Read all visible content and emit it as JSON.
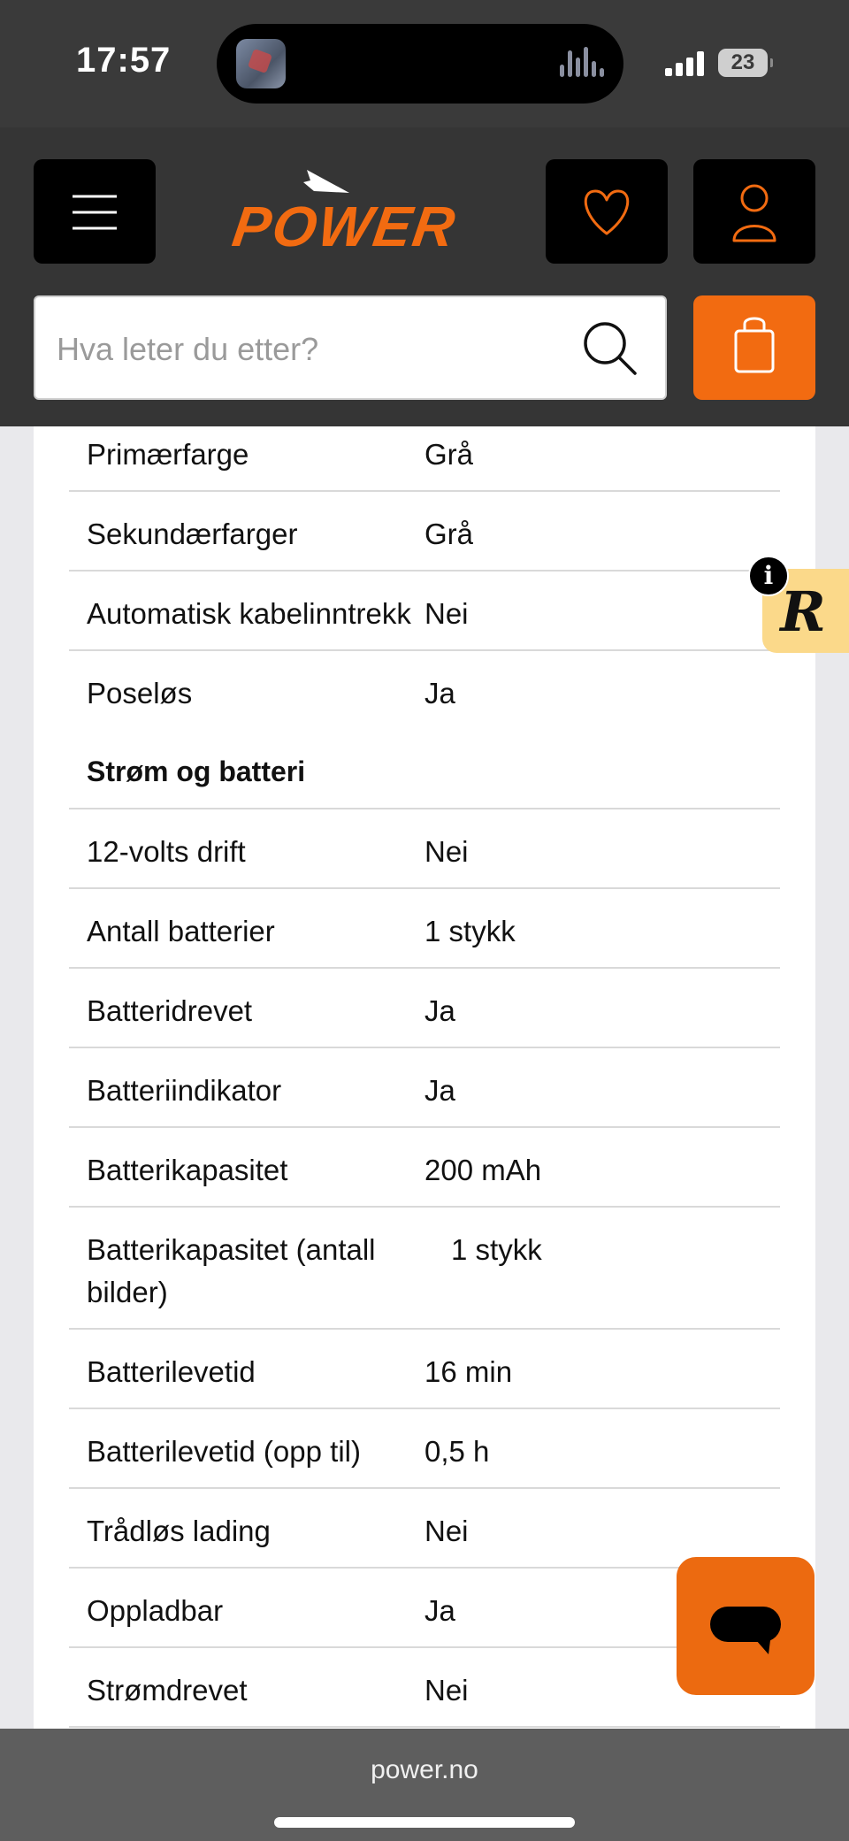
{
  "status_bar": {
    "time": "17:57",
    "battery": "23"
  },
  "header": {
    "logo_text": "POWER",
    "search_placeholder": "Hva leter du etter?"
  },
  "colors": {
    "brand_orange": "#f26b11",
    "header_bg": "#353535",
    "badge_yellow": "#fbd98a"
  },
  "icons": [
    "hamburger-menu-icon",
    "heart-icon",
    "user-icon",
    "search-icon",
    "shopping-bag-icon",
    "info-icon",
    "r-badge-icon",
    "chat-bubble-icon"
  ],
  "specs_top": [
    {
      "label": "Primærfarge",
      "value": "Grå"
    },
    {
      "label": "Sekundærfarger",
      "value": "Grå"
    },
    {
      "label": "Automatisk kabelinntrekk",
      "value": "Nei"
    },
    {
      "label": "Poseløs",
      "value": "Ja"
    }
  ],
  "section_title": "Strøm og batteri",
  "specs_power": [
    {
      "label": "12-volts drift",
      "value": "Nei"
    },
    {
      "label": "Antall batterier",
      "value": "1 stykk"
    },
    {
      "label": "Batteridrevet",
      "value": "Ja"
    },
    {
      "label": "Batteriindikator",
      "value": "Ja"
    },
    {
      "label": "Batterikapasitet",
      "value": "200 mAh"
    },
    {
      "label": "Batterikapasitet (antall bilder)",
      "value": "1 stykk"
    },
    {
      "label": "Batterilevetid",
      "value": "16 min"
    },
    {
      "label": "Batterilevetid (opp til)",
      "value": "0,5 h"
    },
    {
      "label": "Trådløs lading",
      "value": "Nei"
    },
    {
      "label": "Oppladbar",
      "value": "Ja"
    },
    {
      "label": "Strømdrevet",
      "value": "Nei"
    }
  ],
  "browser": {
    "url": "power.no"
  }
}
